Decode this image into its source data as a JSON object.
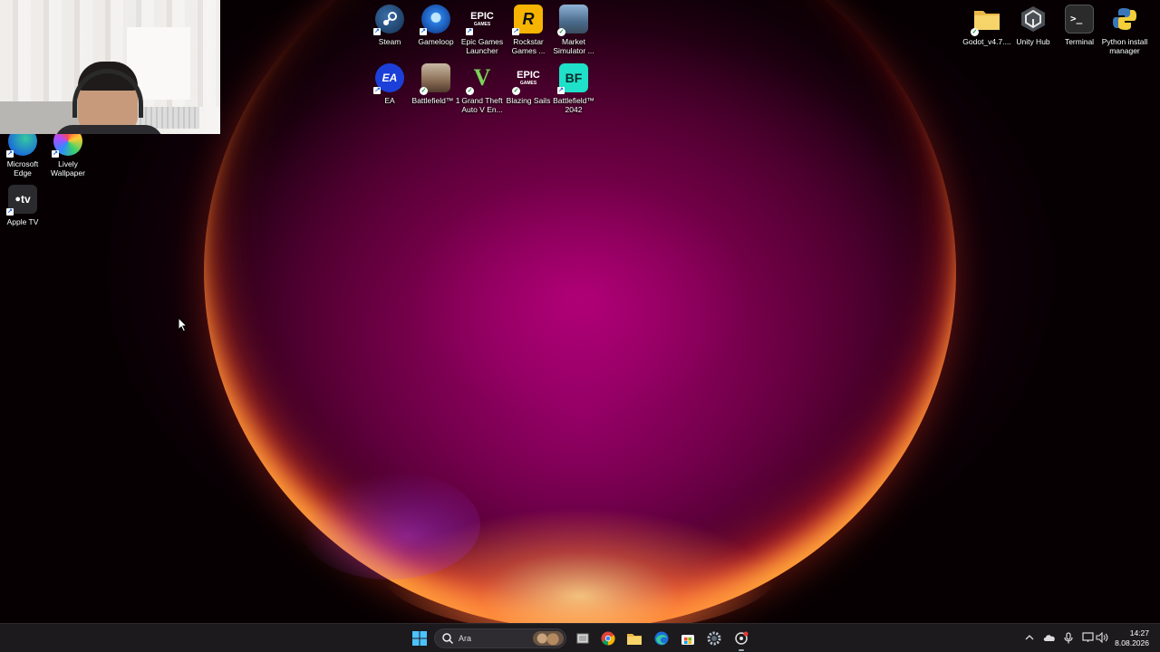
{
  "desktop": {
    "icons": [
      {
        "label": "Steam"
      },
      {
        "label": "Gameloop"
      },
      {
        "label": "Epic Games Launcher"
      },
      {
        "label": "Rockstar Games ..."
      },
      {
        "label": "Market Simulator ..."
      },
      {
        "label": "EA"
      },
      {
        "label": "Battlefield™ 1"
      },
      {
        "label": "Grand Theft Auto V En..."
      },
      {
        "label": "Blazing Sails"
      },
      {
        "label": "Battlefield™ 2042"
      },
      {
        "label": "Godot_v4.7...."
      },
      {
        "label": "Unity Hub"
      },
      {
        "label": "Terminal"
      },
      {
        "label": "Python install manager"
      },
      {
        "label": "Microsoft Edge"
      },
      {
        "label": "Lively Wallpaper"
      },
      {
        "label": "Apple TV"
      }
    ],
    "icon_glyphs": {
      "epic": "EPIC",
      "epic_sub": "GAMES",
      "rockstar": "R",
      "ea": "EA",
      "gta": "V",
      "bf2042": "BF",
      "appletv": "tv"
    }
  },
  "taskbar": {
    "search_placeholder": "Ara",
    "apps": [
      "start-icon",
      "task-view-icon",
      "chrome-icon",
      "file-explorer-icon",
      "edge-icon",
      "microsoft-store-icon",
      "settings-icon",
      "recorder-icon"
    ],
    "tray_icons": [
      "chevron-up-icon",
      "onedrive-icon",
      "microphone-icon",
      "display-icon",
      "volume-icon"
    ],
    "time": "14:27",
    "date": "8.08.2026"
  }
}
